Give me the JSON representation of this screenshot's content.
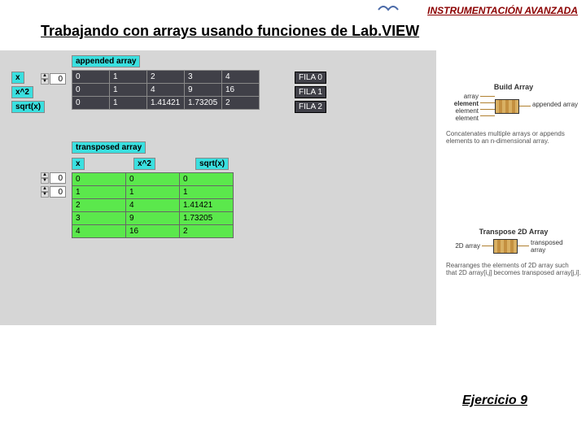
{
  "header": {
    "brand": "INSTRUMENTACIÓN AVANZADA"
  },
  "title": "Trabajando con arrays usando funciones de Lab.VIEW",
  "row_labels": [
    "x",
    "x^2",
    "sqrt(x)"
  ],
  "transposed_headers": [
    "x",
    "x^2",
    "sqrt(x)"
  ],
  "appended_label": "appended array",
  "transposed_label": "transposed array",
  "fila_labels": [
    "FILA 0",
    "FILA 1",
    "FILA 2"
  ],
  "appended_index": "0",
  "transposed_index_a": "0",
  "transposed_index_b": "0",
  "appended_array": [
    [
      "0",
      "1",
      "2",
      "3",
      "4"
    ],
    [
      "0",
      "1",
      "4",
      "9",
      "16"
    ],
    [
      "0",
      "1",
      "1.41421",
      "1.73205",
      "2"
    ]
  ],
  "transposed_array": [
    [
      "0",
      "0",
      "0"
    ],
    [
      "1",
      "1",
      "1"
    ],
    [
      "2",
      "4",
      "1.41421"
    ],
    [
      "3",
      "9",
      "1.73205"
    ],
    [
      "4",
      "16",
      "2"
    ]
  ],
  "help_build": {
    "title": "Build Array",
    "in_labels": [
      "array",
      "element",
      "element",
      "element"
    ],
    "out_label": "appended array",
    "desc": "Concatenates multiple arrays or appends elements to an n-dimensional array."
  },
  "help_transpose": {
    "title": "Transpose 2D Array",
    "in_label": "2D array",
    "out_label": "transposed array",
    "desc": "Rearranges the elements of 2D array such that 2D array[i,j] becomes transposed array[j,i]."
  },
  "footer": "Ejercicio 9",
  "chart_data": {
    "type": "table",
    "tables": [
      {
        "name": "appended array",
        "row_labels": [
          "x",
          "x^2",
          "sqrt(x)"
        ],
        "columns": [
          "0",
          "1",
          "2",
          "3",
          "4"
        ],
        "rows": [
          [
            0,
            1,
            2,
            3,
            4
          ],
          [
            0,
            1,
            4,
            9,
            16
          ],
          [
            0,
            1,
            1.41421,
            1.73205,
            2
          ]
        ]
      },
      {
        "name": "transposed array",
        "column_labels": [
          "x",
          "x^2",
          "sqrt(x)"
        ],
        "rows": [
          [
            0,
            0,
            0
          ],
          [
            1,
            1,
            1
          ],
          [
            2,
            4,
            1.41421
          ],
          [
            3,
            9,
            1.73205
          ],
          [
            4,
            16,
            2
          ]
        ]
      }
    ]
  }
}
